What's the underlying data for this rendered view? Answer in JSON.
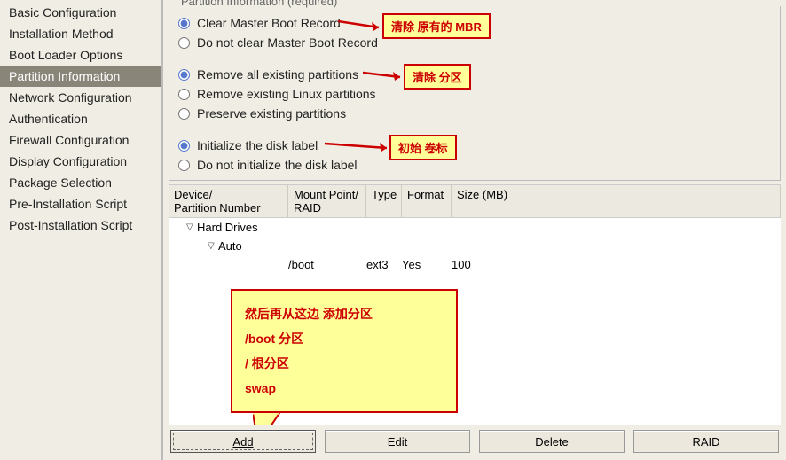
{
  "sidebar": {
    "items": [
      {
        "label": "Basic Configuration",
        "selected": false
      },
      {
        "label": "Installation Method",
        "selected": false
      },
      {
        "label": "Boot Loader Options",
        "selected": false
      },
      {
        "label": "Partition Information",
        "selected": true
      },
      {
        "label": "Network Configuration",
        "selected": false
      },
      {
        "label": "Authentication",
        "selected": false
      },
      {
        "label": "Firewall Configuration",
        "selected": false
      },
      {
        "label": "Display Configuration",
        "selected": false
      },
      {
        "label": "Package Selection",
        "selected": false
      },
      {
        "label": "Pre-Installation Script",
        "selected": false
      },
      {
        "label": "Post-Installation Script",
        "selected": false
      }
    ]
  },
  "groupbox": {
    "title": "Partition Information (required)",
    "mbr": {
      "clear": "Clear Master Boot Record",
      "noclear": "Do not clear Master Boot Record",
      "selected": "clear"
    },
    "partitions": {
      "removeAll": "Remove all existing partitions",
      "removeLinux": "Remove existing Linux partitions",
      "preserve": "Preserve existing partitions",
      "selected": "removeAll"
    },
    "disklabel": {
      "init": "Initialize the disk label",
      "noinit": "Do not initialize the disk label",
      "selected": "init"
    }
  },
  "callouts": {
    "mbr": "清除 原有的 MBR",
    "partitions": "清除 分区",
    "disklabel": "初始 卷标",
    "speech_line1": "然后再从这边 添加分区",
    "speech_line2": "/boot  分区",
    "speech_line3": "/   根分区",
    "speech_line4": "swap"
  },
  "table": {
    "headers": {
      "device": "Device/\nPartition Number",
      "mount": "Mount Point/\nRAID",
      "type": "Type",
      "format": "Format",
      "size": "Size (MB)"
    },
    "tree": {
      "hardDrives": "Hard Drives",
      "auto": "Auto",
      "rows": [
        {
          "mount": "/boot",
          "type": "ext3",
          "format": "Yes",
          "size": "100"
        }
      ]
    }
  },
  "buttons": {
    "add": "Add",
    "edit": "Edit",
    "delete": "Delete",
    "raid": "RAID"
  }
}
